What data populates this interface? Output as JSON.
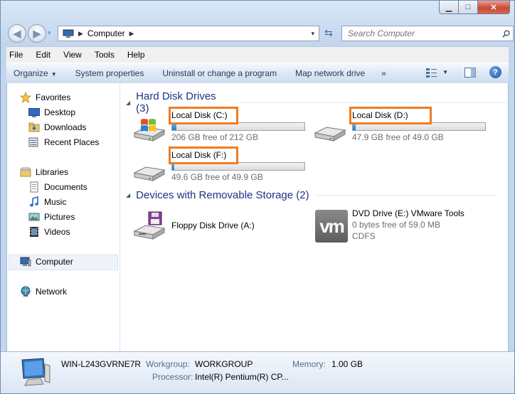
{
  "window": {
    "minimize": "▁",
    "maximize": "□",
    "close": "✕"
  },
  "nav": {
    "back": "◀",
    "forward": "▶",
    "dropdown": "▾",
    "address": {
      "crumb": "Computer",
      "sep": "▶",
      "dd": "▾"
    },
    "refresh": "⇆",
    "search_placeholder": "Search Computer"
  },
  "menu": [
    "File",
    "Edit",
    "View",
    "Tools",
    "Help"
  ],
  "toolbar": {
    "organize": "Organize",
    "organize_arrow": "▼",
    "system_properties": "System properties",
    "uninstall": "Uninstall or change a program",
    "map_drive": "Map network drive",
    "more": "»",
    "views_arrow": "▼",
    "help": "?"
  },
  "navpane": {
    "favorites": "Favorites",
    "desktop": "Desktop",
    "downloads": "Downloads",
    "recent": "Recent Places",
    "libraries": "Libraries",
    "documents": "Documents",
    "music": "Music",
    "pictures": "Pictures",
    "videos": "Videos",
    "computer": "Computer",
    "network": "Network"
  },
  "groups": {
    "hdd": "Hard Disk Drives (3)",
    "removable": "Devices with Removable Storage (2)"
  },
  "drives": {
    "c": {
      "name": "Local Disk (C:)",
      "free": "206 GB free of 212 GB",
      "used_fraction": 0.03
    },
    "d": {
      "name": "Local Disk (D:)",
      "free": "47.9 GB free of 49.0 GB",
      "used_fraction": 0.02
    },
    "f": {
      "name": "Local Disk (F:)",
      "free": "49.6 GB free of 49.9 GB",
      "used_fraction": 0.005
    }
  },
  "removable": {
    "floppy": {
      "name": "Floppy Disk Drive (A:)"
    },
    "dvd": {
      "name": "DVD Drive (E:) VMware Tools",
      "free": "0 bytes free of 59.0 MB",
      "fs": "CDFS",
      "logo": "vm"
    }
  },
  "details": {
    "computer_name": "WIN-L243GVRNE7R",
    "workgroup_label": "Workgroup:",
    "workgroup": "WORKGROUP",
    "memory_label": "Memory:",
    "memory": "1.00 GB",
    "processor_label": "Processor:",
    "processor": "Intel(R) Pentium(R) CP..."
  },
  "colors": {
    "highlight": "#f07c22",
    "accent": "#1e3287",
    "bar_fill": "#1f7ec9"
  }
}
